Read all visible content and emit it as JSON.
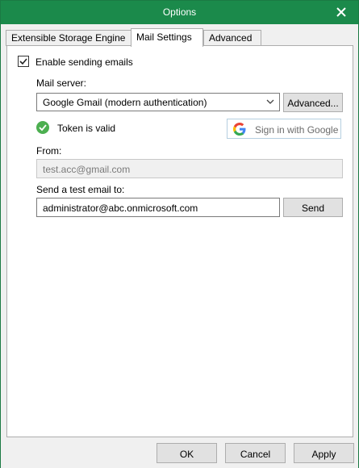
{
  "window": {
    "title": "Options"
  },
  "tabs": [
    {
      "label": "Extensible Storage Engine",
      "active": false
    },
    {
      "label": "Mail Settings",
      "active": true
    },
    {
      "label": "Advanced",
      "active": false
    }
  ],
  "mail": {
    "enable_label": "Enable sending emails",
    "enable_checked": true,
    "server_label": "Mail server:",
    "server_value": "Google Gmail (modern authentication)",
    "advanced_button": "Advanced...",
    "token_status": "Token is valid",
    "signin_button": "Sign in with Google",
    "from_label": "From:",
    "from_value": "test.acc@gmail.com",
    "test_label": "Send a test email to:",
    "test_value": "administrator@abc.onmicrosoft.com",
    "send_button": "Send"
  },
  "footer": {
    "ok": "OK",
    "cancel": "Cancel",
    "apply": "Apply"
  },
  "colors": {
    "titlebar": "#1b8a4b",
    "status_ok": "#4caf50"
  }
}
